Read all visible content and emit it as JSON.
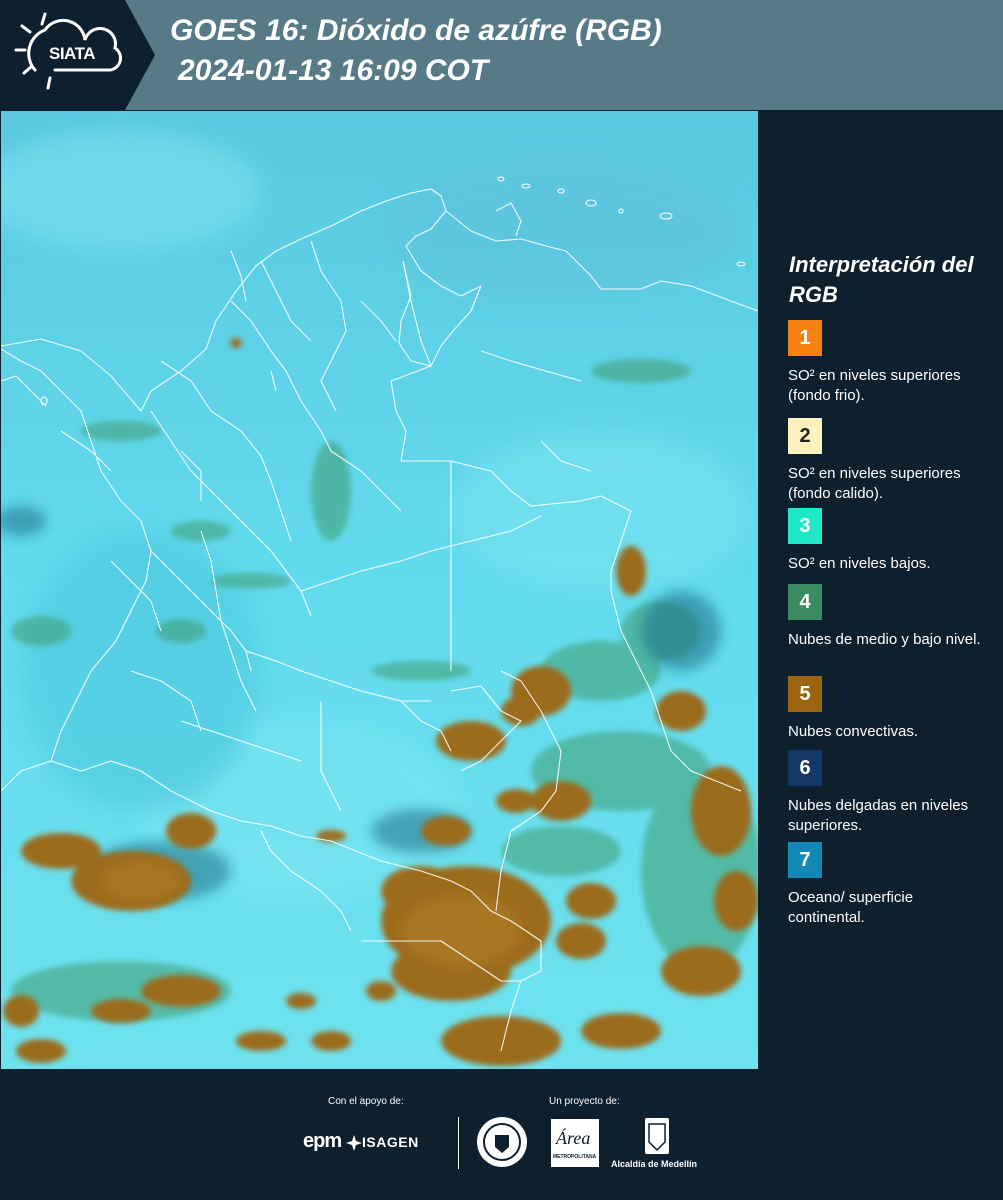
{
  "header": {
    "logo_text": "SIATA",
    "title_line1": "GOES 16: Dióxido de azúfre (RGB)",
    "title_line2": "2024-01-13 16:09 COT"
  },
  "legend": {
    "title": "Interpretación del RGB",
    "items": [
      {
        "number": "1",
        "color": "#f5820f",
        "label": "SO² en niveles superiores (fondo frio)."
      },
      {
        "number": "2",
        "color": "#fbf2bd",
        "label": "SO² en niveles superiores (fondo calido)."
      },
      {
        "number": "3",
        "color": "#1fe8c8",
        "label": "SO² en niveles bajos."
      },
      {
        "number": "4",
        "color": "#3b8a62",
        "label": "Nubes de medio y bajo nivel."
      },
      {
        "number": "5",
        "color": "#9b6410",
        "label": "Nubes convectivas."
      },
      {
        "number": "6",
        "color": "#133866",
        "label": "Nubes delgadas en niveles superiores."
      },
      {
        "number": "7",
        "color": "#1388b5",
        "label": "Oceano/ superficie continental."
      }
    ]
  },
  "footer": {
    "support_label": "Con el apoyo de:",
    "project_label": "Un proyecto de:",
    "sponsor1": "epm",
    "sponsor2": "ISAGEN",
    "project_logo_area": "Área",
    "project_logo_area_sub": "METROPOLITANA",
    "project_logo_alcaldia": "Alcaldía de Medellín"
  },
  "colors": {
    "background": "#0e1f2d",
    "header": "#577a87",
    "sky": "#58d4e6",
    "cloud_convective": "#9b6c1c",
    "cloud_low": "#3b8a62"
  }
}
